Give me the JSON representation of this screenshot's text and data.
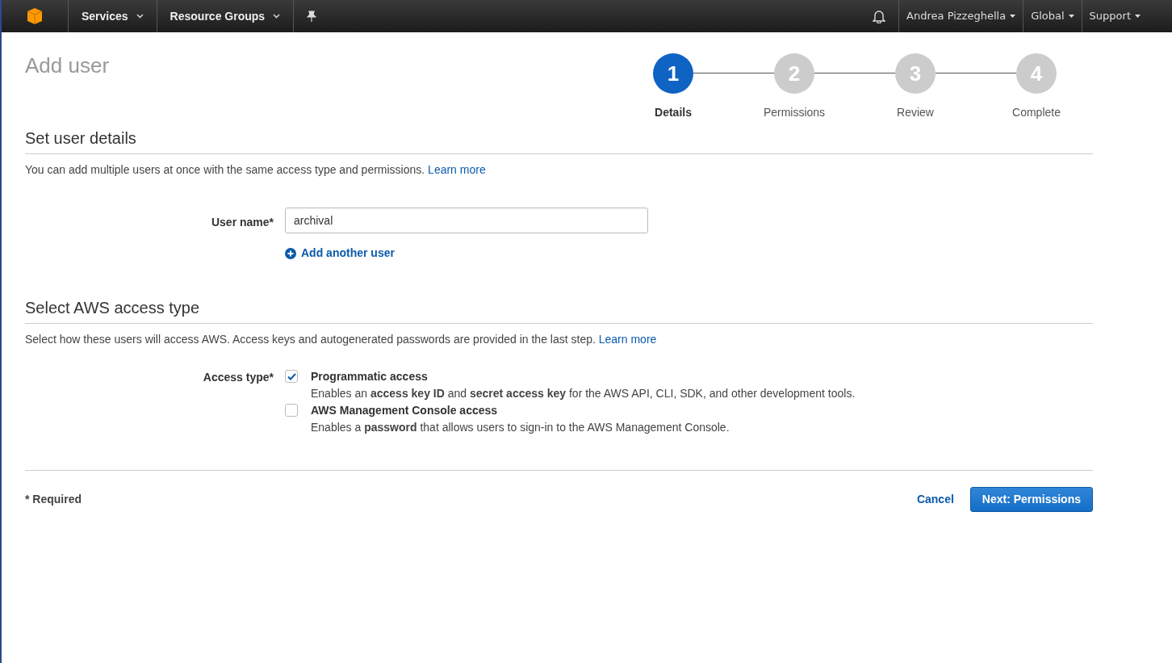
{
  "nav": {
    "left": [
      {
        "label": "Services"
      },
      {
        "label": "Resource Groups"
      }
    ],
    "right": [
      {
        "label": "Andrea Pizzeghella"
      },
      {
        "label": "Global"
      },
      {
        "label": "Support"
      }
    ]
  },
  "page_title": "Add user",
  "steps": [
    {
      "number": "1",
      "label": "Details",
      "selected": true
    },
    {
      "number": "2",
      "label": "Permissions",
      "selected": false
    },
    {
      "number": "3",
      "label": "Review",
      "selected": false
    },
    {
      "number": "4",
      "label": "Complete",
      "selected": false
    }
  ],
  "sections": [
    {
      "title": "Set user details",
      "description": "You can add multiple users at once with the same access type and permissions.",
      "link": "Learn more"
    },
    {
      "title": "Select AWS access type",
      "description": "Select how these users will access AWS. Access keys and autogenerated passwords are provided in the last step.",
      "link": "Learn more"
    }
  ],
  "user_name": {
    "label": "User name*",
    "value": "archival",
    "add_link": "Add another user"
  },
  "access_type": {
    "label": "Access type*",
    "options": [
      {
        "label": "Programmatic access",
        "description": "Enables an **access key ID** and **secret access key** for the AWS API, CLI, SDK, and other development tools.",
        "checked": true
      },
      {
        "label": "AWS Management Console access",
        "description": "Enables a **password** that allows users to sign-in to the AWS Management Console.",
        "checked": false
      }
    ]
  },
  "footer": {
    "required_note": "* Required",
    "cancel": "Cancel",
    "next": "Next: Permissions"
  }
}
